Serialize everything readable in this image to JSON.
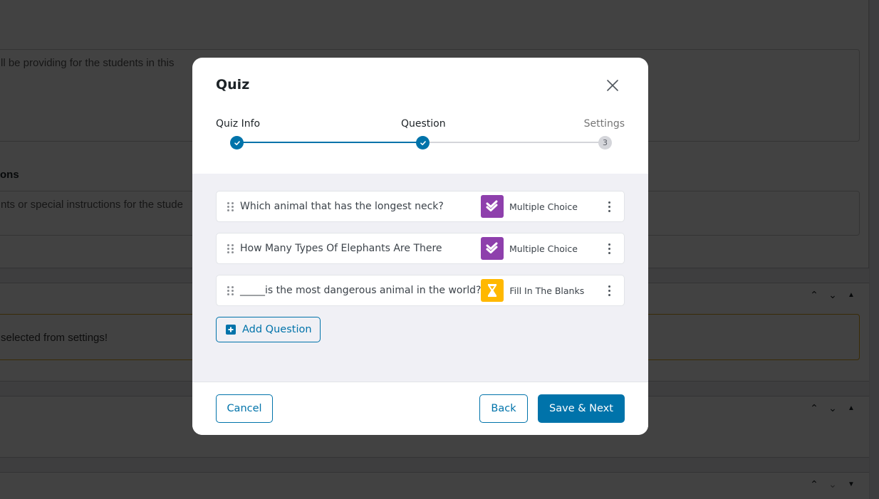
{
  "background": {
    "textarea1_text": "ll be providing for the students in this",
    "section_heading": "ons",
    "textarea2_text": "nts or special instructions for the stude",
    "notice_text": "selected from settings!"
  },
  "modal": {
    "title": "Quiz",
    "steps": [
      {
        "label": "Quiz Info",
        "state": "done"
      },
      {
        "label": "Question",
        "state": "done"
      },
      {
        "label": "Settings",
        "state": "pending",
        "number": "3"
      }
    ],
    "questions": [
      {
        "text": "Which animal that has the longest neck?",
        "type": "Multiple Choice",
        "type_icon": "double-check-icon",
        "type_color": "#8e3fac"
      },
      {
        "text": "How Many Types Of Elephants Are There",
        "type": "Multiple Choice",
        "type_icon": "double-check-icon",
        "type_color": "#8e3fac"
      },
      {
        "text": "_____is the most dangerous animal in the world?",
        "type": "Fill In The Blanks",
        "type_icon": "hourglass-icon",
        "type_color": "#ffb800"
      }
    ],
    "add_question_label": "Add Question",
    "footer": {
      "cancel_label": "Cancel",
      "back_label": "Back",
      "save_next_label": "Save & Next"
    }
  },
  "colors": {
    "accent": "#0073aa",
    "multiple_choice": "#8e3fac",
    "fill_blanks": "#ffb800"
  }
}
